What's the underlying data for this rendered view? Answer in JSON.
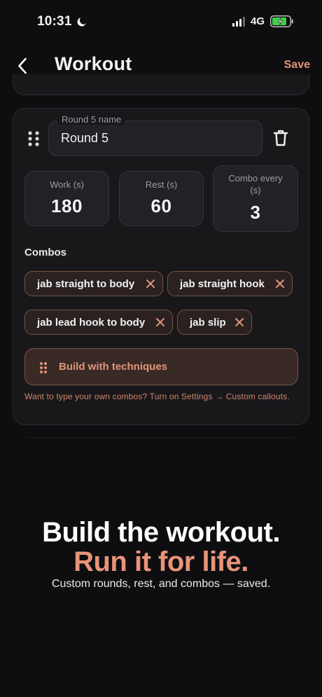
{
  "status_bar": {
    "time": "10:31",
    "network": "4G"
  },
  "nav": {
    "title": "Workout",
    "save_label": "Save"
  },
  "round": {
    "name_label": "Round 5 name",
    "name_value": "Round 5",
    "stats": {
      "work": {
        "label": "Work (s)",
        "value": "180"
      },
      "rest": {
        "label": "Rest (s)",
        "value": "60"
      },
      "combo_every": {
        "label_line1": "Combo every",
        "label_line2": "(s)",
        "value": "3"
      }
    },
    "combos_heading": "Combos",
    "combos": [
      "jab straight to body",
      "jab straight hook",
      "jab lead hook to body",
      "jab slip"
    ],
    "build_label": "Build with techniques",
    "hint": "Want to type your own combos? Turn on Settings → Custom callouts."
  },
  "promo": {
    "headline": "Build the workout.",
    "tagline": "Run it for life.",
    "subtitle": "Custom rounds, rest, and combos — saved."
  },
  "colors": {
    "accent": "#e0957a",
    "background": "#0e0e10",
    "card": "#18181b",
    "chip_border": "#7a5247",
    "battery_fill": "#3ecf4a"
  }
}
